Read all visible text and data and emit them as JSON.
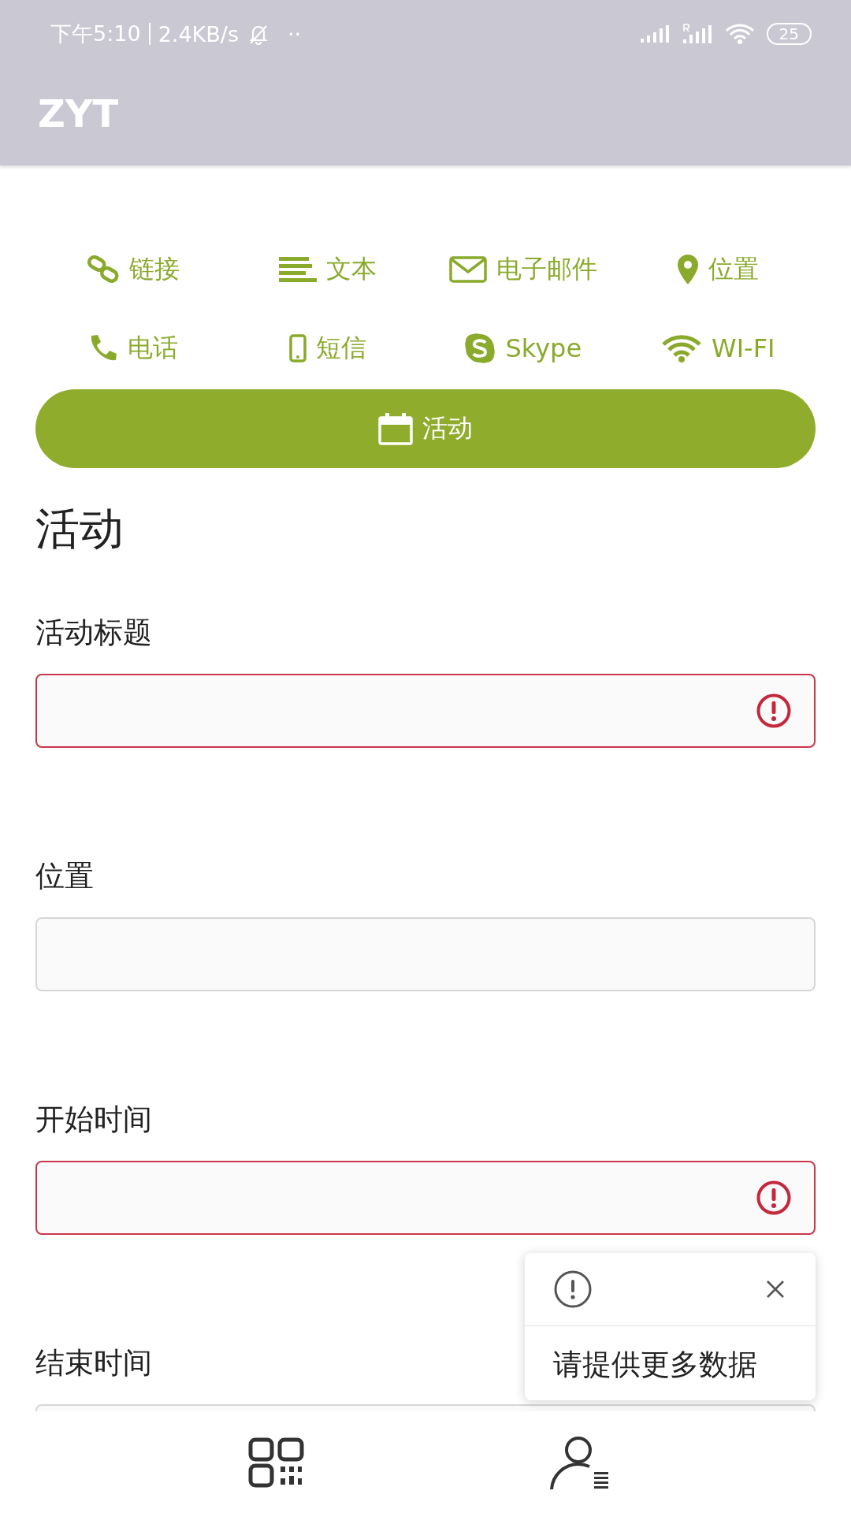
{
  "status_bar": {
    "time": "下午5:10",
    "speed": "2.4KB/s",
    "dots": "··",
    "battery": "25"
  },
  "app_bar": {
    "title": "ZYT"
  },
  "types": [
    {
      "label": "链接",
      "selected": false
    },
    {
      "label": "文本",
      "selected": false
    },
    {
      "label": "电子邮件",
      "selected": false
    },
    {
      "label": "位置",
      "selected": false
    },
    {
      "label": "电话",
      "selected": false
    },
    {
      "label": "短信",
      "selected": false
    },
    {
      "label": "Skype",
      "selected": false
    },
    {
      "label": "WI-FI",
      "selected": false
    },
    {
      "label": "活动",
      "selected": true
    }
  ],
  "form": {
    "heading": "活动",
    "fields": [
      {
        "label": "活动标题",
        "invalid": true
      },
      {
        "label": "位置",
        "invalid": false
      },
      {
        "label": "开始时间",
        "invalid": true
      },
      {
        "label": "结束时间",
        "invalid": false
      }
    ]
  },
  "toast": {
    "message": "请提供更多数据"
  }
}
